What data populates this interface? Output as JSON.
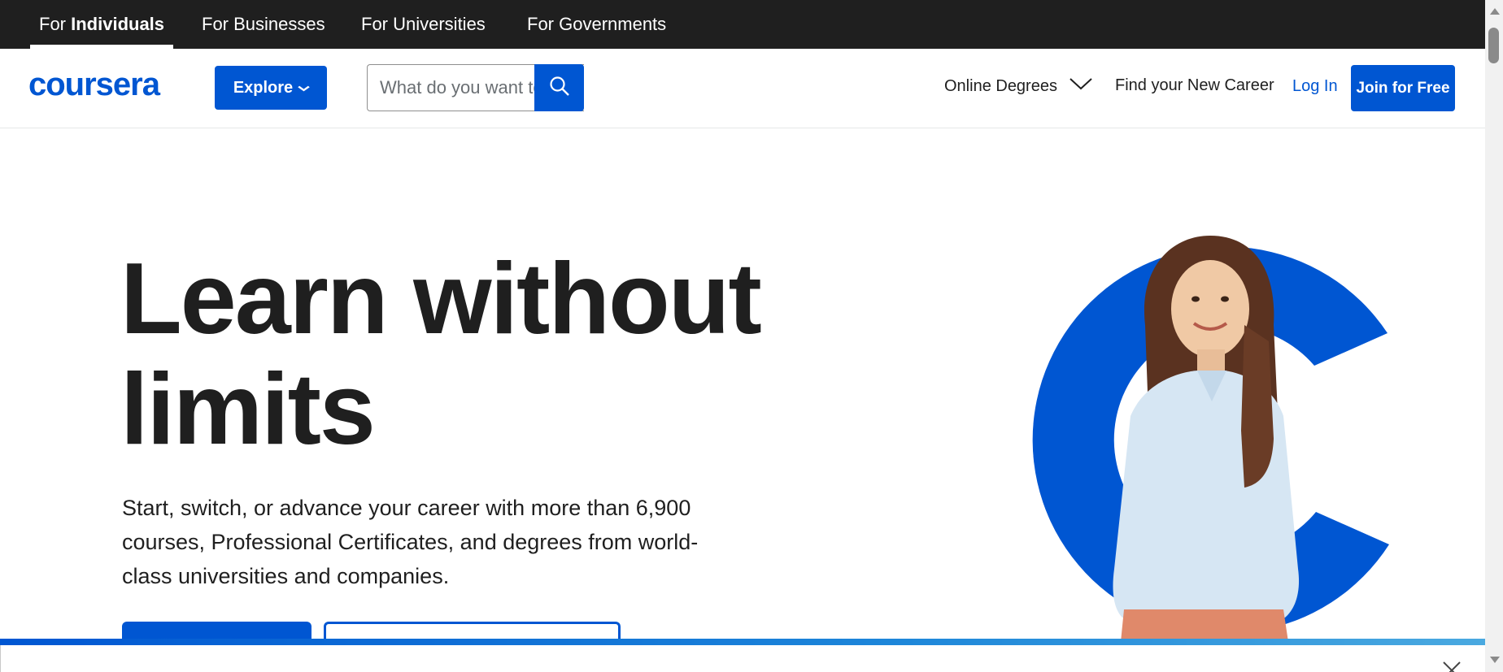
{
  "audience_tabs": [
    {
      "prefix": "For ",
      "bold": "Individuals"
    },
    {
      "label": "For Businesses"
    },
    {
      "label": "For Universities"
    },
    {
      "label": "For Governments"
    }
  ],
  "header": {
    "logo": "coursera",
    "explore_label": "Explore",
    "search_placeholder": "What do you want to learn?",
    "nav": {
      "degrees": "Online Degrees",
      "career": "Find your New Career",
      "login": "Log In",
      "join": "Join for Free"
    }
  },
  "hero": {
    "title_line1": "Learn without",
    "title_line2": "limits",
    "subtitle": "Start, switch, or advance your career with more than 6,900 courses, Professional Certificates, and degrees from world-class universities and companies."
  },
  "icons": {
    "explore_chevron": "chevron-down-icon",
    "search": "search-icon",
    "degrees_chevron": "chevron-down-icon",
    "close": "close-icon"
  },
  "colors": {
    "brand_blue": "#0056d2",
    "topbar_bg": "#1f1f1f",
    "text": "#1f1f1f"
  }
}
